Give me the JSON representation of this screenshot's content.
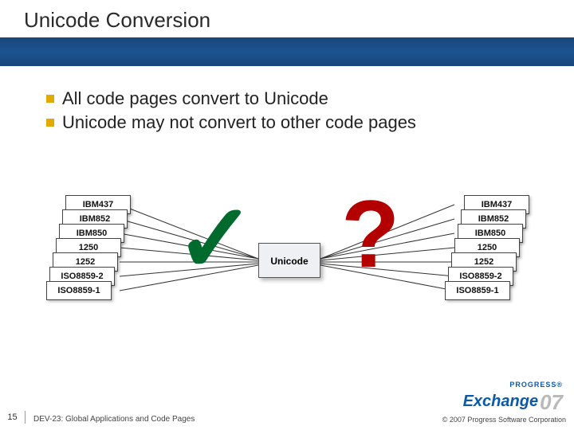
{
  "title": "Unicode Conversion",
  "bullets": [
    "All code pages convert to Unicode",
    "Unicode may not convert to other code pages"
  ],
  "codepages": [
    "IBM437",
    "IBM852",
    "IBM850",
    "1250",
    "1252",
    "ISO8859-2",
    "ISO8859-1"
  ],
  "center_label": "Unicode",
  "marks": {
    "ok": "✓",
    "bad": "?"
  },
  "brand": {
    "top": "PROGRESS®",
    "main": "Exchange",
    "year": "07"
  },
  "footer": {
    "slide_no": "15",
    "session": "DEV-23: Global Applications and Code Pages",
    "copyright": "© 2007 Progress Software Corporation"
  }
}
